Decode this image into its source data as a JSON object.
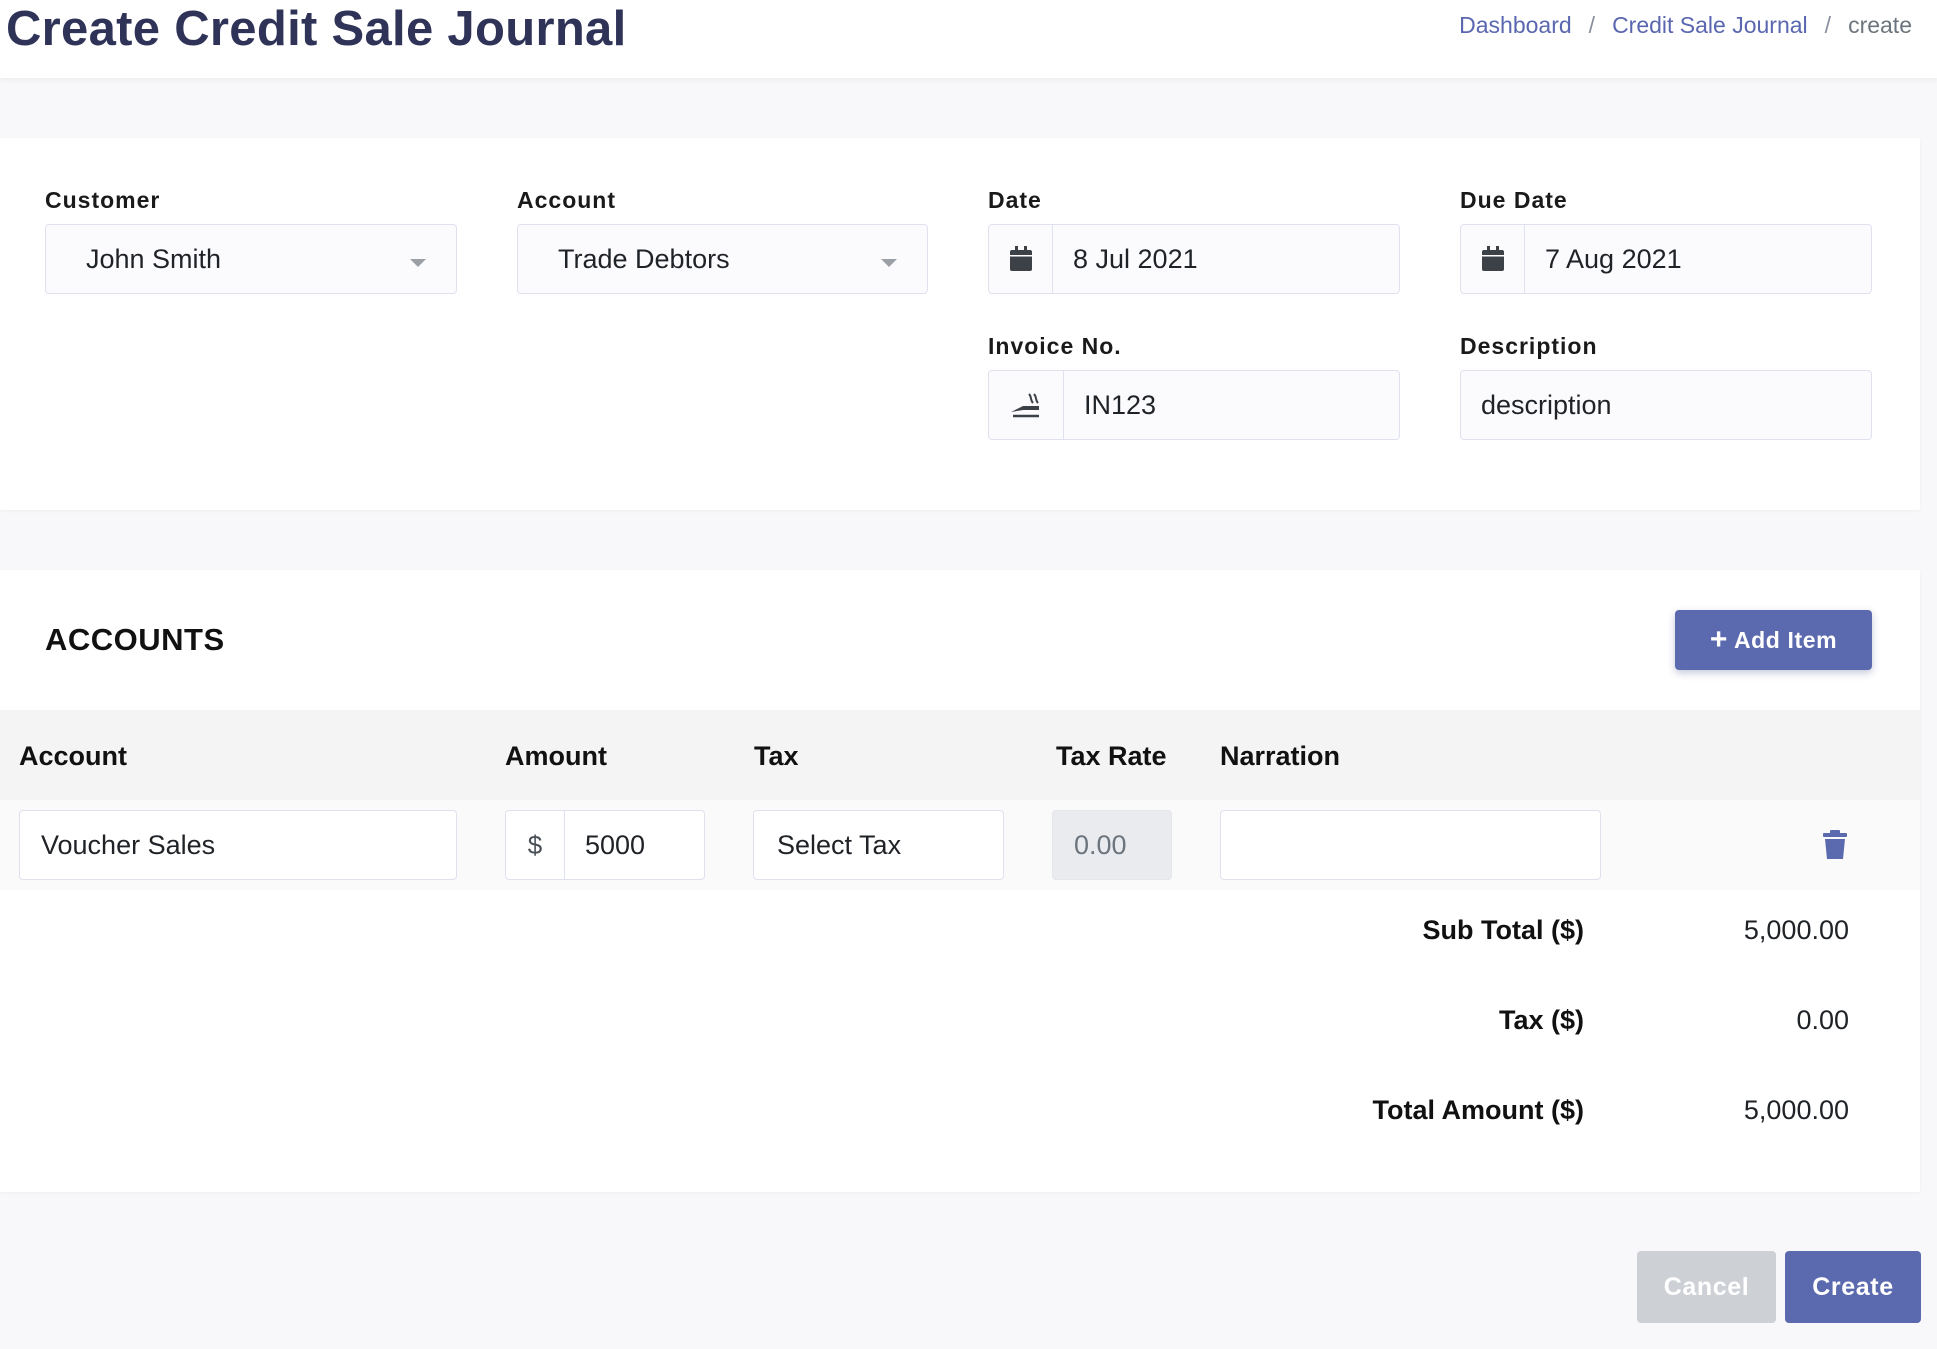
{
  "header": {
    "title": "Create Credit Sale Journal",
    "breadcrumb": [
      {
        "label": "Dashboard"
      },
      {
        "label": "Credit Sale Journal"
      },
      {
        "label": "create"
      }
    ],
    "separator": "/"
  },
  "form": {
    "customer": {
      "label": "Customer",
      "value": "John Smith"
    },
    "account": {
      "label": "Account",
      "value": "Trade Debtors"
    },
    "date": {
      "label": "Date",
      "value": "8 Jul 2021",
      "icon": "calendar-icon"
    },
    "due_date": {
      "label": "Due Date",
      "value": "7 Aug 2021",
      "icon": "calendar-icon"
    },
    "invoice_no": {
      "label": "Invoice No.",
      "value": "IN123",
      "icon": "invoice-icon"
    },
    "description": {
      "label": "Description",
      "value": "description"
    }
  },
  "accounts": {
    "title": "ACCOUNTS",
    "add_item_label": "Add Item",
    "columns": {
      "account": "Account",
      "amount": "Amount",
      "tax": "Tax",
      "tax_rate": "Tax Rate",
      "narration": "Narration"
    },
    "rows": [
      {
        "account": "Voucher Sales",
        "currency": "$",
        "amount": "5000",
        "tax": "Select Tax",
        "tax_rate": "0.00",
        "narration": ""
      }
    ],
    "totals": {
      "sub_total_label": "Sub Total ($)",
      "sub_total_value": "5,000.00",
      "tax_label": "Tax ($)",
      "tax_value": "0.00",
      "total_label": "Total Amount ($)",
      "total_value": "5,000.00"
    }
  },
  "actions": {
    "cancel_label": "Cancel",
    "create_label": "Create"
  },
  "colors": {
    "primary": "#5b6aae",
    "title": "#2f3358",
    "link": "#5a67b0",
    "cancel": "#cdd0d5"
  }
}
